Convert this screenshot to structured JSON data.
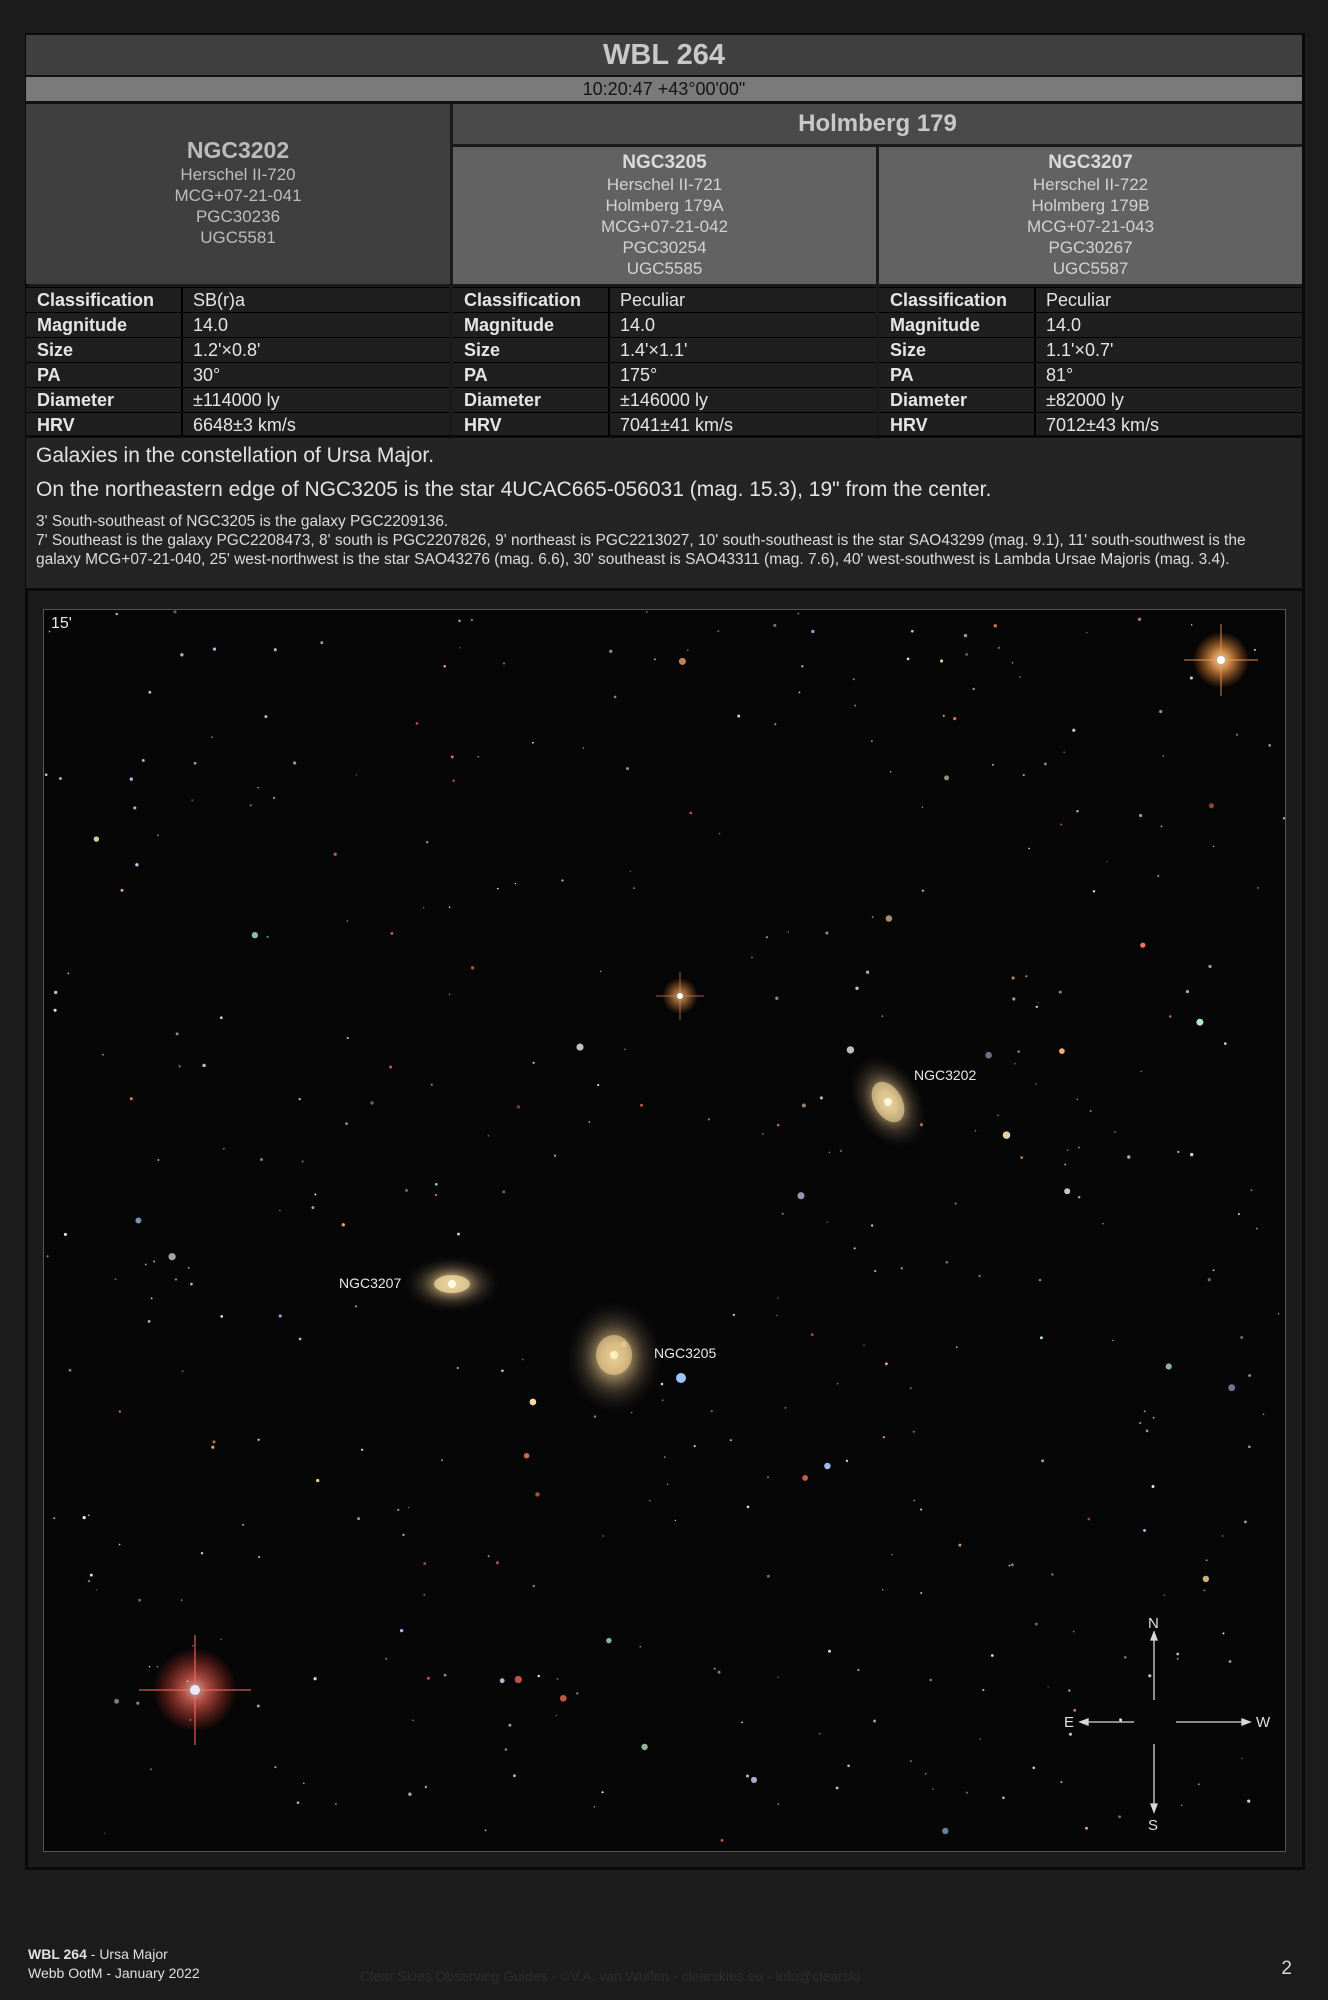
{
  "header": {
    "title": "WBL 264",
    "coords": "10:20:47 +43°00'00\""
  },
  "group": {
    "name": "Holmberg 179"
  },
  "galaxies": [
    {
      "name": "NGC3202",
      "aliases": [
        "Herschel II-720",
        "MCG+07-21-041",
        "PGC30236",
        "UGC5581"
      ],
      "props": {
        "classification": "SB(r)a",
        "magnitude": "14.0",
        "size": "1.2'×0.8'",
        "pa": "30°",
        "diameter": "±114000 ly",
        "hrv": "6648±3 km/s"
      }
    },
    {
      "name": "NGC3205",
      "aliases": [
        "Herschel II-721",
        "Holmberg 179A",
        "MCG+07-21-042",
        "PGC30254",
        "UGC5585"
      ],
      "props": {
        "classification": "Peculiar",
        "magnitude": "14.0",
        "size": "1.4'×1.1'",
        "pa": "175°",
        "diameter": "±146000 ly",
        "hrv": "7041±41 km/s"
      }
    },
    {
      "name": "NGC3207",
      "aliases": [
        "Herschel II-722",
        "Holmberg 179B",
        "MCG+07-21-043",
        "PGC30267",
        "UGC5587"
      ],
      "props": {
        "classification": "Peculiar",
        "magnitude": "14.0",
        "size": "1.1'×0.7'",
        "pa": "81°",
        "diameter": "±82000 ly",
        "hrv": "7012±43 km/s"
      }
    }
  ],
  "prop_labels": {
    "classification": "Classification",
    "magnitude": "Magnitude",
    "size": "Size",
    "pa": "PA",
    "diameter": "Diameter",
    "hrv": "HRV"
  },
  "description": {
    "line1": "Galaxies in the constellation of Ursa Major.",
    "line2": "On the northeastern edge of NGC3205 is the star 4UCAC665-056031 (mag. 15.3), 19\" from the center.",
    "line3": "3' South-southeast of NGC3205 is the galaxy PGC2209136.",
    "line4": "7' Southeast is the galaxy PGC2208473, 8' south is PGC2207826, 9' northeast is PGC2213027, 10' south-southeast is the star SAO43299 (mag. 9.1), 11' south-southwest is the galaxy MCG+07-21-040, 25' west-northwest is the star SAO43276 (mag. 6.6), 30' southeast is SAO43311 (mag. 7.6), 40' west-southwest is Lambda Ursae Majoris (mag. 3.4)."
  },
  "image": {
    "scale_label": "15'",
    "labels": {
      "ngc3202": "NGC3202",
      "ngc3205": "NGC3205",
      "ngc3207": "NGC3207"
    },
    "compass": {
      "n": "N",
      "s": "S",
      "e": "E",
      "w": "W"
    }
  },
  "footer": {
    "title": "WBL 264",
    "constellation": " - Ursa Major",
    "line2": "Webb OotM - January 2022",
    "credit": "Clear Skies Observing Guides - ©V.A. van Wulfen - clearskies.eu - info@clearski",
    "page": "2"
  }
}
